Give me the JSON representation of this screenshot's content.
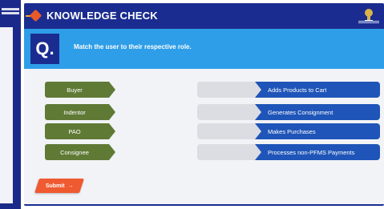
{
  "header": {
    "title": "KNOWLEDGE CHECK"
  },
  "question": {
    "marker": "Q.",
    "text": "Match the user to their respective role."
  },
  "left_items": [
    {
      "label": "Buyer"
    },
    {
      "label": "Indentor"
    },
    {
      "label": "PAO"
    },
    {
      "label": "Consignee"
    }
  ],
  "right_items": [
    {
      "label": "Adds Products to Cart"
    },
    {
      "label": "Generates Consignment"
    },
    {
      "label": "Makes Purchases"
    },
    {
      "label": "Processes non-PFMS Payments"
    }
  ],
  "submit": {
    "label": "Submit",
    "icon": "arrow-right-icon",
    "arrow": "→"
  },
  "colors": {
    "topbar": "#1a2c8f",
    "question_band": "#2f9ee8",
    "left_item": "#5f7a35",
    "right_item": "#1f55b8",
    "slot": "#dcdde2",
    "submit": "#ef5a30"
  }
}
